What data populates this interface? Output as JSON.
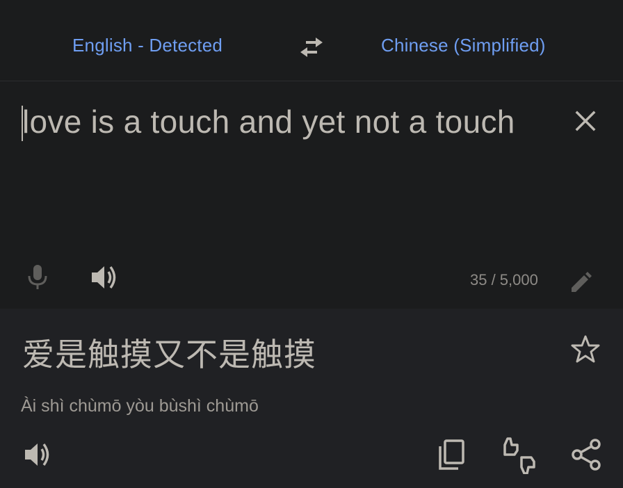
{
  "languages": {
    "source": "English - Detected",
    "target": "Chinese (Simplified)",
    "swap_icon": "swap-arrows-icon"
  },
  "input": {
    "text": "love is a touch and yet not a touch",
    "char_count": "35 / 5,000",
    "icons": [
      "close-icon",
      "microphone-icon",
      "speaker-icon",
      "pencil-icon"
    ]
  },
  "output": {
    "translation": "爱是触摸又不是触摸",
    "romanization": "Ài shì chùmō yòu bùshì chùmō",
    "icons": [
      "star-icon",
      "speaker-icon",
      "copy-icon",
      "feedback-icon",
      "share-icon"
    ]
  },
  "colors": {
    "background": "#1b1c1d",
    "output_background": "#202124",
    "accent": "#6f9ef2",
    "text": "#bdb9b2",
    "icon": "#bdb9b2"
  }
}
